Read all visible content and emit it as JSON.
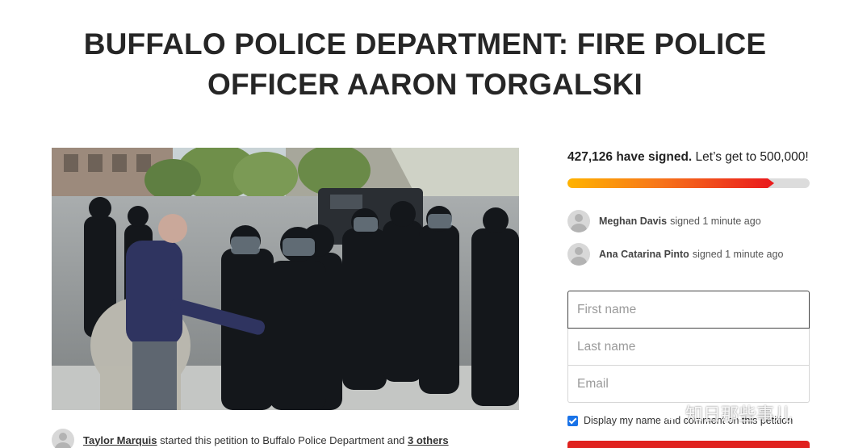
{
  "petition": {
    "title_line1": "BUFFALO POLICE DEPARTMENT: FIRE POLICE",
    "title_line2": "OFFICER AARON TORGALSKI"
  },
  "signatures": {
    "count": "427,126 have signed.",
    "goal_text": " Let’s get to 500,000!",
    "progress_fraction": 0.854,
    "bar_colors": [
      "#ffb300",
      "#f7771a",
      "#ea1d1d"
    ]
  },
  "recent_signers": [
    {
      "name": "Meghan Davis",
      "action": "signed 1 minute ago"
    },
    {
      "name": "Ana Catarina Pinto",
      "action": "signed 1 minute ago"
    }
  ],
  "form": {
    "first_name_placeholder": "First name",
    "last_name_placeholder": "Last name",
    "email_placeholder": "Email",
    "display_checkbox_label": "Display my name and comment on this petition",
    "display_checked": true
  },
  "starter": {
    "name": "Taylor Marquis",
    "middle": " started this petition to Buffalo Police Department and ",
    "others": "3 others"
  },
  "watermark": {
    "text": "知日那些事儿"
  },
  "colors": {
    "accent_red": "#e0221f",
    "checkbox_blue": "#1a73e8"
  }
}
